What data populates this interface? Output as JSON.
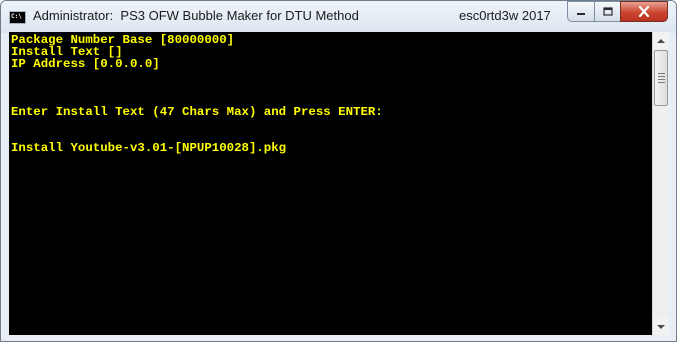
{
  "window": {
    "title": "Administrator:  PS3 OFW Bubble Maker for DTU Method",
    "title_right": "esc0rtd3w 2017",
    "app_icon_label": "C:\\",
    "icons": {
      "app": "console-icon",
      "minimize": "minimize-icon",
      "maximize": "maximize-icon",
      "close": "close-icon",
      "scroll_up": "chevron-up-icon",
      "scroll_down": "chevron-down-icon"
    }
  },
  "console": {
    "text_color": "#ffff00",
    "background": "#000000",
    "lines": [
      "Package Number Base [80000000]",
      "Install Text []",
      "IP Address [0.0.0.0]",
      "Enter Install Text (47 Chars Max) and Press ENTER:",
      "Install Youtube-v3.01-[NPUP10028].pkg"
    ]
  }
}
